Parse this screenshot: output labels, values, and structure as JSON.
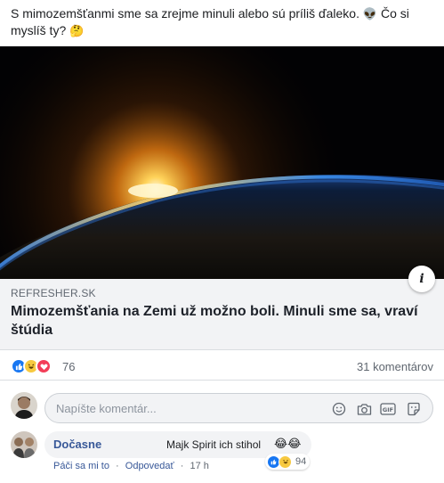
{
  "post": {
    "text": "S mimozemšťanmi sme sa zrejme minuli alebo sú príliš ďaleko.",
    "text_emoji": "👽",
    "text2": "Čo si myslíš ty?",
    "text2_emoji": "🤔"
  },
  "link": {
    "domain": "REFRESHER.SK",
    "title": "Mimozemšťania na Zemi už možno boli. Minuli sme sa, vraví štúdia",
    "info_icon": "i"
  },
  "reactions": {
    "icons": [
      "like-icon",
      "haha-icon",
      "love-icon"
    ],
    "count": "76",
    "comments": "31 komentárov"
  },
  "composer": {
    "placeholder": "Napíšte komentár...",
    "tools": [
      "emoji-icon",
      "camera-icon",
      "gif-icon",
      "sticker-icon"
    ]
  },
  "comment": {
    "author": "Dočasne",
    "text": "Majk Spirit ich stihol",
    "emoji": "😂😂",
    "reaction_count": "94",
    "action_like": "Páči sa mi to",
    "action_reply": "Odpovedať",
    "time": "17 h"
  },
  "colors": {
    "link_blue": "#385898",
    "like_blue": "#1877f2",
    "love_red": "#f33e58",
    "haha_yellow": "#f7c940"
  }
}
